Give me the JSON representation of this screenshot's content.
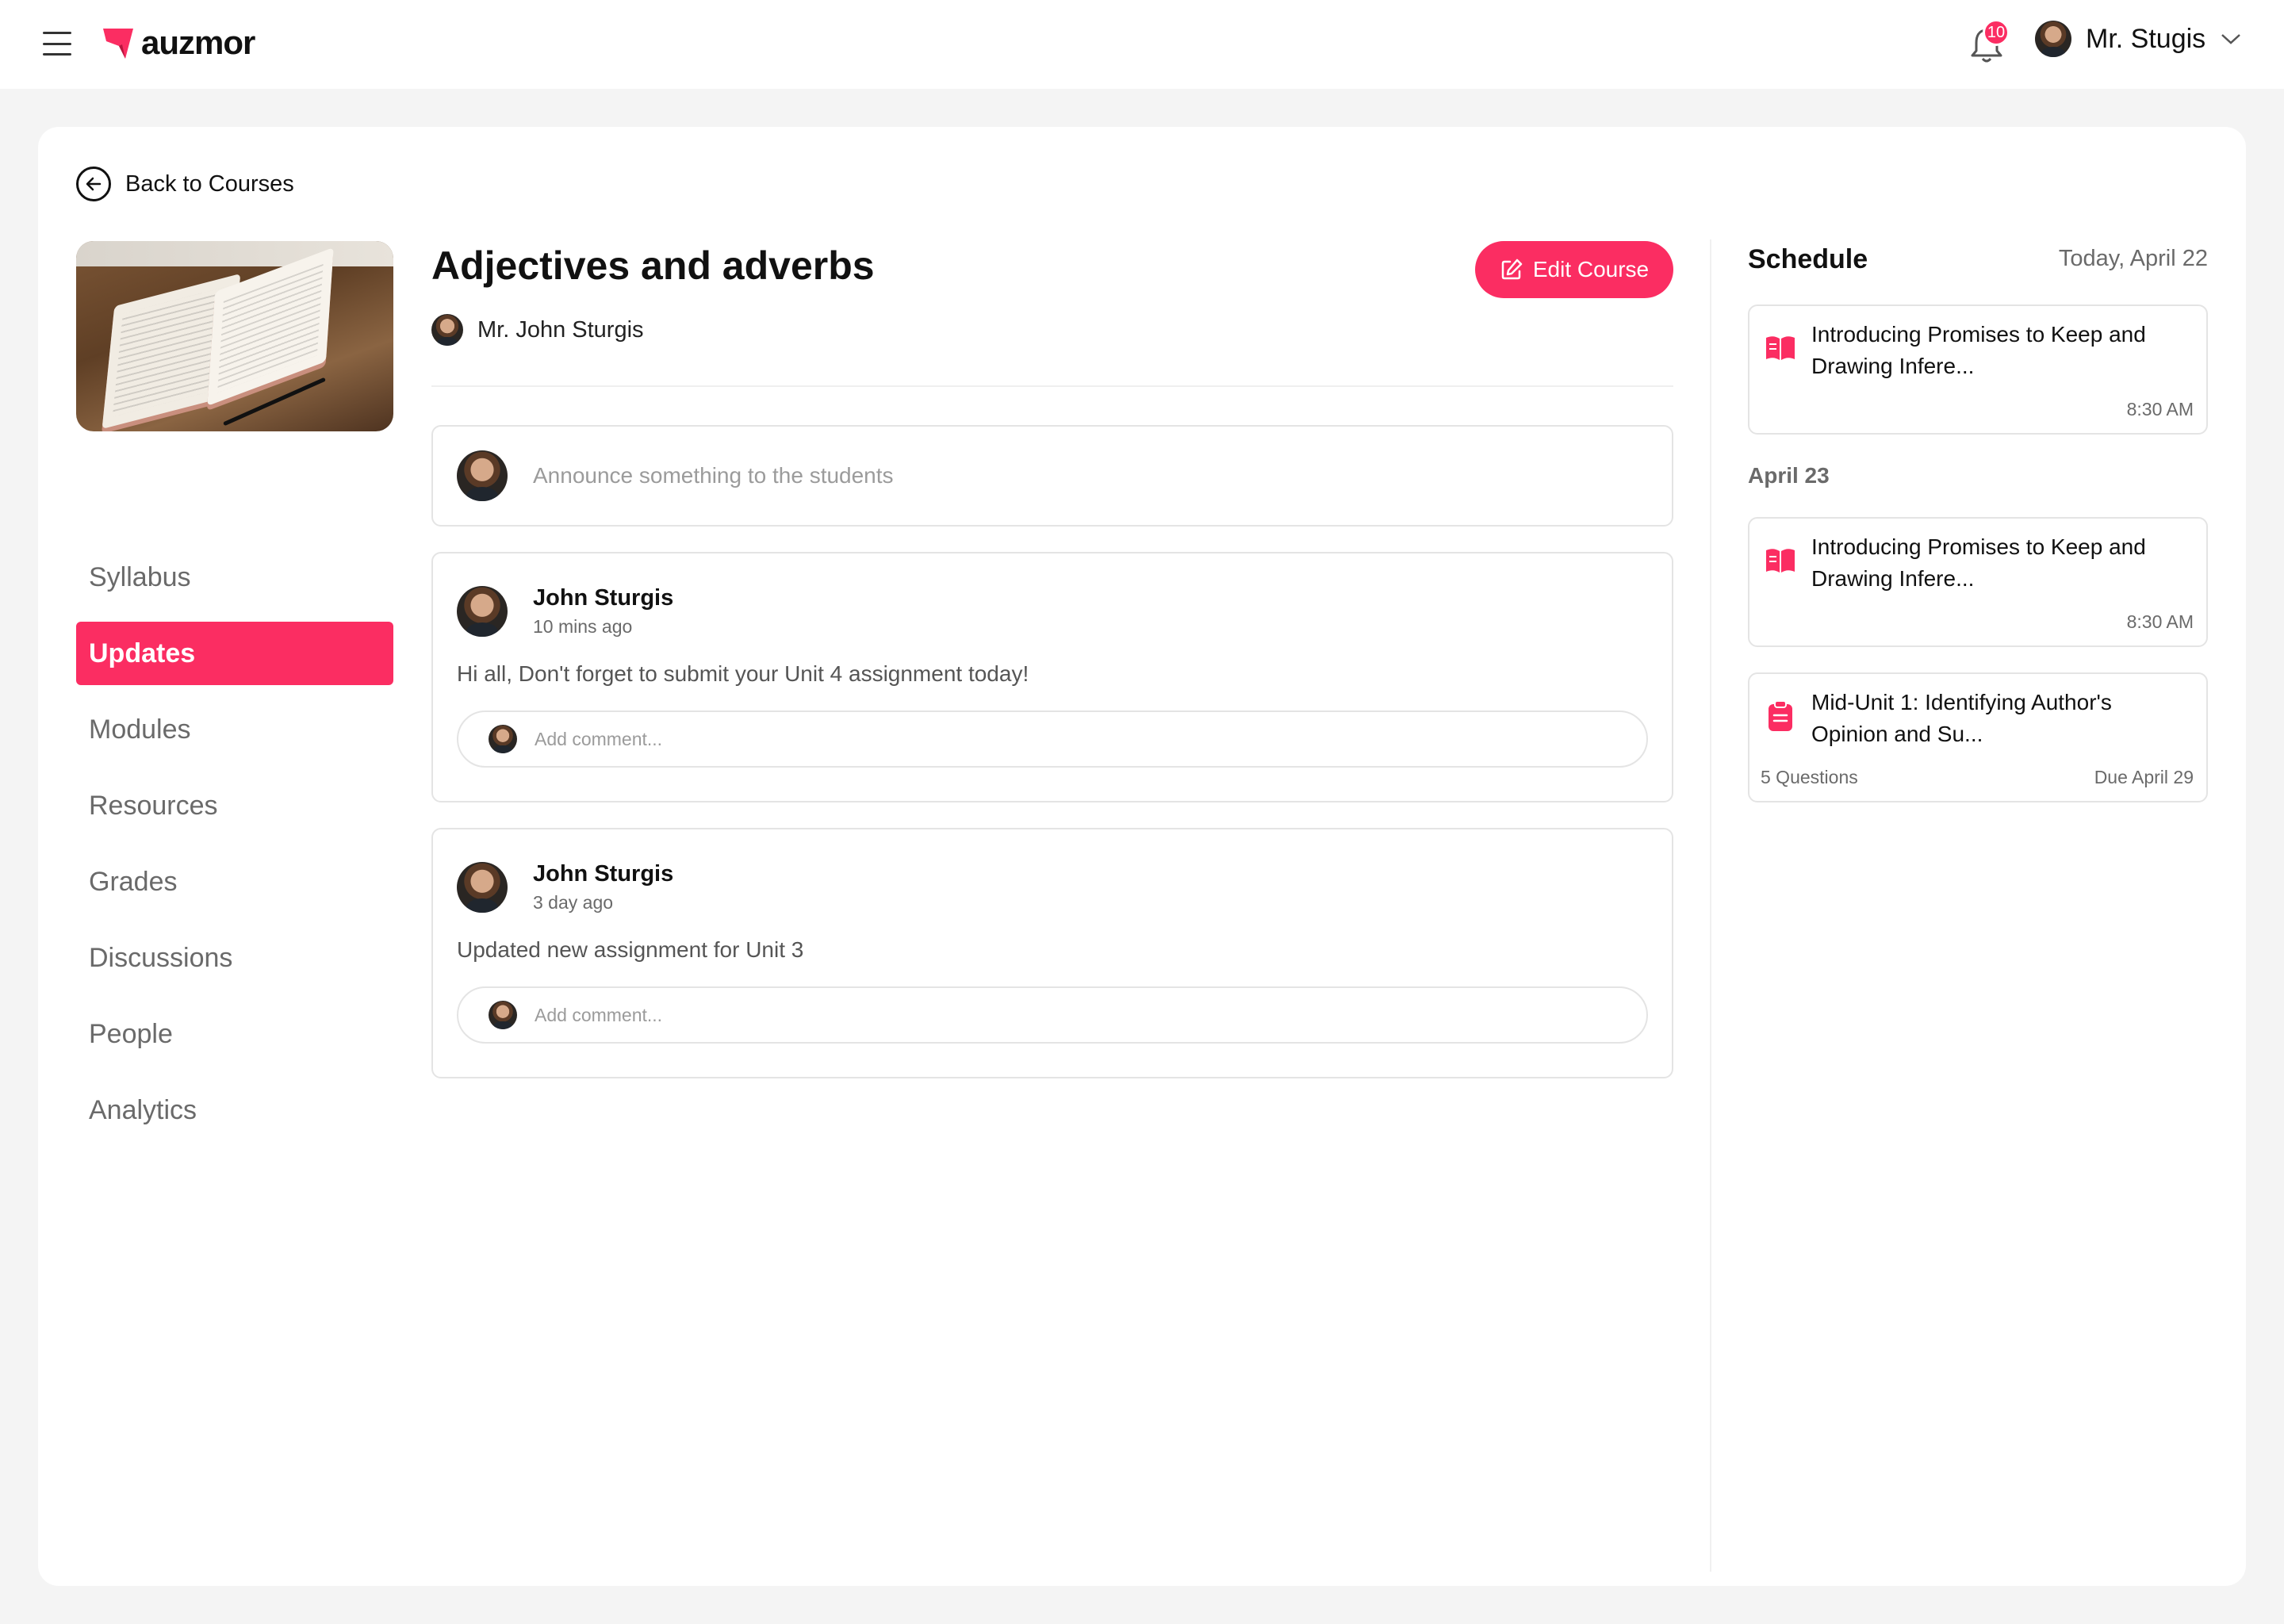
{
  "app": {
    "name": "auzmor",
    "brand_color": "#fb2d62"
  },
  "topbar": {
    "notifications_count": "10",
    "user_name": "Mr. Stugis"
  },
  "back": {
    "label": "Back to Courses"
  },
  "course": {
    "title": "Adjectives and adverbs",
    "teacher": "Mr. John Sturgis",
    "edit_label": "Edit Course"
  },
  "nav": {
    "items": [
      {
        "label": "Syllabus"
      },
      {
        "label": "Updates",
        "active": true
      },
      {
        "label": "Modules"
      },
      {
        "label": "Resources"
      },
      {
        "label": "Grades"
      },
      {
        "label": "Discussions"
      },
      {
        "label": "People"
      },
      {
        "label": "Analytics"
      }
    ]
  },
  "announce": {
    "placeholder": "Announce something to the students"
  },
  "posts": [
    {
      "author": "John Sturgis",
      "time": "10 mins ago",
      "body": "Hi all, Don't forget to submit your Unit 4 assignment today!",
      "comment_placeholder": "Add comment..."
    },
    {
      "author": "John Sturgis",
      "time": "3 day ago",
      "body": "Updated new assignment for Unit 3",
      "comment_placeholder": "Add comment..."
    }
  ],
  "schedule": {
    "title": "Schedule",
    "today": "Today, April 22",
    "day2": "April 23",
    "items": [
      {
        "icon": "book-icon",
        "title": "Introducing Promises to Keep and Drawing Infere...",
        "time": "8:30 AM"
      },
      {
        "icon": "book-icon",
        "title": "Introducing Promises to Keep and Drawing Infere...",
        "time": "8:30 AM"
      },
      {
        "icon": "clipboard-icon",
        "title": "Mid-Unit 1: Identifying Author's Opinion and Su...",
        "meta": "5 Questions",
        "due": "Due April 29"
      }
    ]
  }
}
